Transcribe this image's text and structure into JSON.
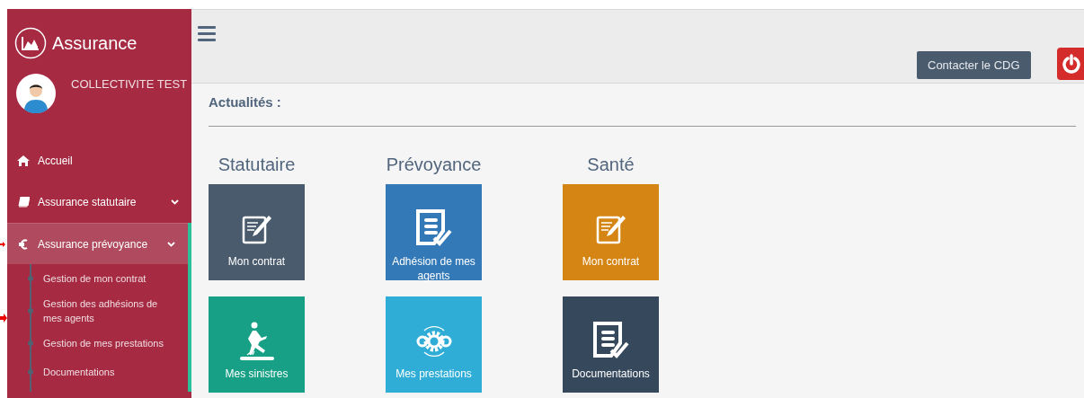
{
  "sidebar": {
    "brand": "Assurance",
    "user": "COLLECTIVITE TEST",
    "items": [
      {
        "kind": "home",
        "label": "Accueil",
        "selected": false,
        "collapsible": false
      },
      {
        "kind": "book",
        "label": "Assurance statutaire",
        "selected": false,
        "collapsible": true
      },
      {
        "kind": "euro",
        "label": "Assurance prévoyance",
        "selected": true,
        "collapsible": true,
        "expanded": true,
        "children": [
          {
            "label": "Gestion de mon contrat"
          },
          {
            "label": "Gestion des adhésions de mes agents"
          },
          {
            "label": "Gestion de mes prestations"
          },
          {
            "label": "Documentations"
          }
        ]
      }
    ]
  },
  "header": {
    "contact_button": "Contacter le CDG"
  },
  "news": {
    "title": "Actualités :"
  },
  "sections": [
    {
      "title": "Statutaire",
      "tiles": [
        {
          "kind": "edit",
          "label": "Mon contrat",
          "color": "#4a5b6d"
        },
        {
          "kind": "fall",
          "label": "Mes sinistres",
          "color": "#17a085"
        }
      ]
    },
    {
      "title": "Prévoyance",
      "tiles": [
        {
          "kind": "doc",
          "label": "Adhésion de mes agents",
          "color": "#3378b7"
        },
        {
          "kind": "gears",
          "label": "Mes prestations",
          "color": "#2fadd6"
        }
      ]
    },
    {
      "title": "Santé",
      "tiles": [
        {
          "kind": "edit",
          "label": "Mon contrat",
          "color": "#d48513"
        },
        {
          "kind": "doc",
          "label": "Documentations",
          "color": "#36495c"
        }
      ]
    }
  ]
}
